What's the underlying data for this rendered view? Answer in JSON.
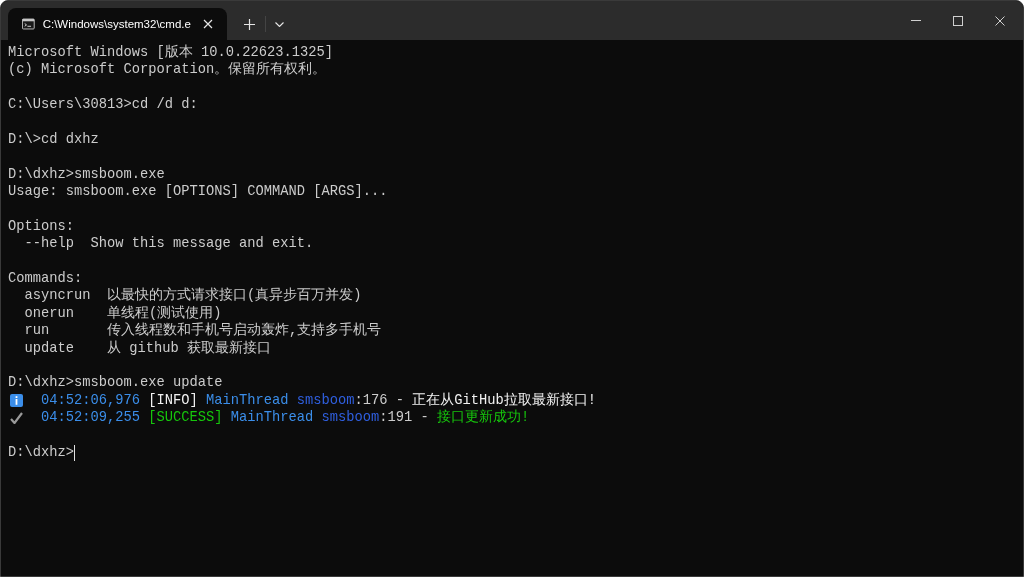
{
  "window": {
    "tab": {
      "title": "C:\\Windows\\system32\\cmd.e",
      "selected": true
    }
  },
  "terminal": {
    "blocks": [
      {
        "lines": [
          {
            "kind": "text",
            "text": "Microsoft Windows [版本 10.0.22623.1325]"
          },
          {
            "kind": "text",
            "text": "(c) Microsoft Corporation。保留所有权利。"
          }
        ]
      },
      {
        "lines": [
          {
            "kind": "text",
            "text": "C:\\Users\\30813>cd /d d:"
          }
        ]
      },
      {
        "lines": [
          {
            "kind": "text",
            "text": "D:\\>cd dxhz"
          }
        ]
      },
      {
        "lines": [
          {
            "kind": "text",
            "text": "D:\\dxhz>smsboom.exe"
          },
          {
            "kind": "text",
            "text": "Usage: smsboom.exe [OPTIONS] COMMAND [ARGS]..."
          }
        ]
      },
      {
        "lines": [
          {
            "kind": "heading",
            "text": "Options:"
          },
          {
            "kind": "entry",
            "name": "--help",
            "description": "Show this message and exit."
          }
        ]
      },
      {
        "lines": [
          {
            "kind": "heading",
            "text": "Commands:"
          },
          {
            "kind": "entry",
            "name": "asyncrun",
            "description": "以最快的方式请求接口(真异步百万并发)"
          },
          {
            "kind": "entry",
            "name": "onerun",
            "description": "单线程(测试使用)"
          },
          {
            "kind": "entry",
            "name": "run",
            "description": "传入线程数和手机号启动轰炸,支持多手机号"
          },
          {
            "kind": "entry",
            "name": "update",
            "description": "从 github 获取最新接口"
          }
        ]
      },
      {
        "lines": [
          {
            "kind": "text",
            "text": "D:\\dxhz>smsboom.exe update"
          },
          {
            "kind": "info",
            "time": "04:52:06,976",
            "level": "[INFO]",
            "thread": "MainThread",
            "logger": "smsboom",
            "line_no": ":176",
            "separator": "-",
            "message": "正在从GitHub拉取最新接口!"
          },
          {
            "kind": "success",
            "time": "04:52:09,255",
            "level": "[SUCCESS]",
            "thread": "MainThread",
            "logger": "smsboom",
            "line_no": ":191",
            "separator": "-",
            "message": "接口更新成功!"
          }
        ]
      }
    ],
    "prompt": {
      "text": "D:\\dxhz>",
      "cursor": true
    }
  }
}
